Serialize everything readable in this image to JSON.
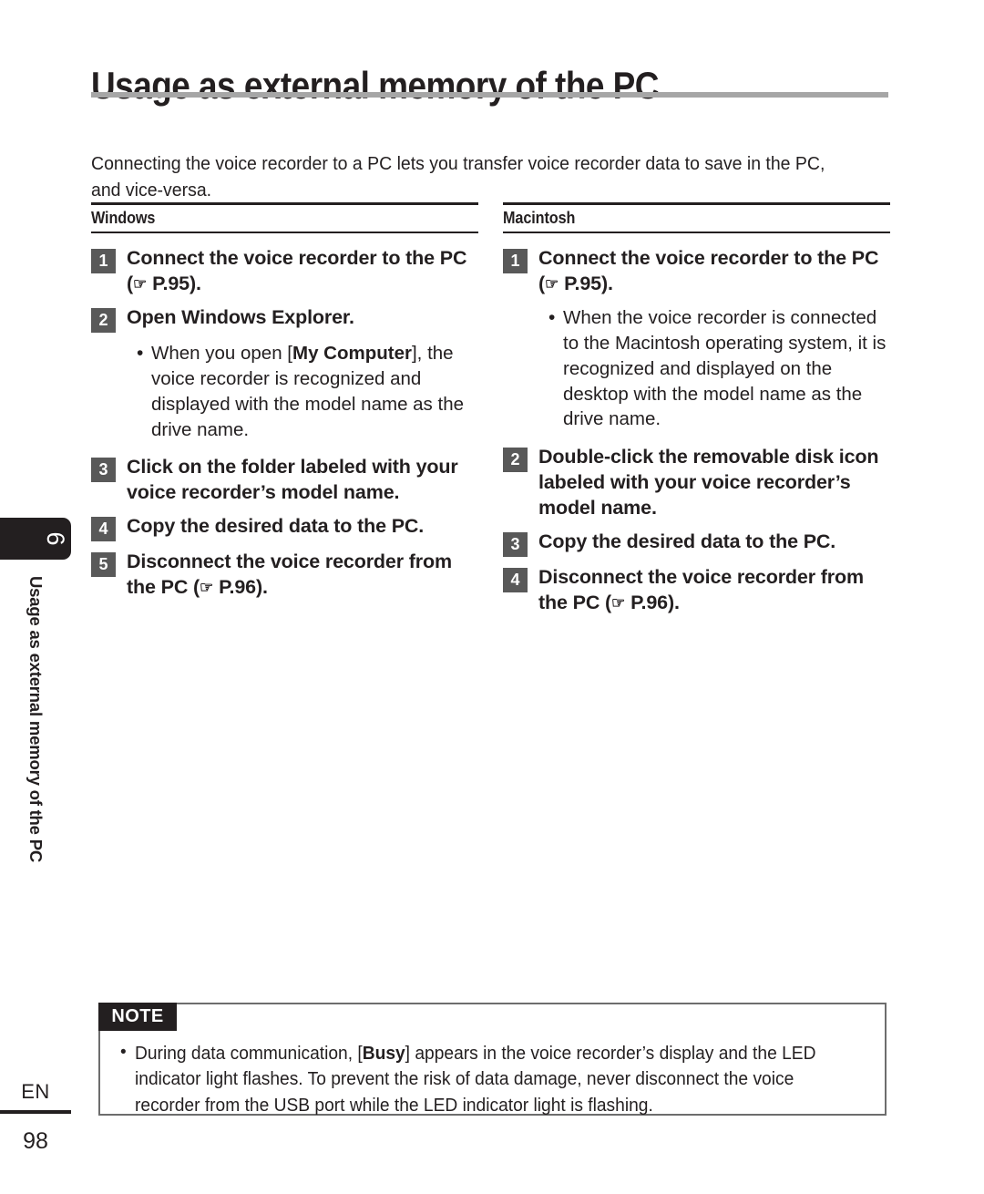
{
  "page": {
    "title": "Usage as external memory of the PC",
    "intro": "Connecting the voice recorder to a PC lets you transfer voice recorder data to save in the PC, and vice-versa.",
    "chapter_number": "6",
    "chapter_running_title": "Usage as external memory of the PC",
    "language_code": "EN",
    "page_number": "98"
  },
  "columns": [
    {
      "heading": "Windows",
      "steps": [
        {
          "number": "1",
          "text_before": "Connect the voice recorder to the PC (",
          "hand_icon": "☞",
          "reference": " P.95",
          "text_after": ")."
        },
        {
          "number": "2",
          "text_before": "Open Windows Explorer.",
          "hand_icon": "",
          "reference": "",
          "text_after": ""
        },
        {
          "number": "3",
          "text_before": "Click on the folder labeled with your voice recorder’s model name.",
          "hand_icon": "",
          "reference": "",
          "text_after": ""
        },
        {
          "number": "4",
          "text_before": "Copy the desired data to the PC.",
          "hand_icon": "",
          "reference": "",
          "text_after": ""
        },
        {
          "number": "5",
          "text_before": "Disconnect the voice recorder from the PC (",
          "hand_icon": "☞",
          "reference": " P.96",
          "text_after": ")."
        }
      ],
      "bullets": [
        {
          "after_step": "2",
          "part1": "When you open [",
          "bold": "My Computer",
          "part2": "], the voice recorder is recognized and displayed with the model name as the drive name."
        }
      ]
    },
    {
      "heading": "Macintosh",
      "steps": [
        {
          "number": "1",
          "text_before": "Connect the voice recorder to the PC (",
          "hand_icon": "☞",
          "reference": " P.95",
          "text_after": ")."
        },
        {
          "number": "2",
          "text_before": "Double-click the removable disk icon labeled with your voice recorder’s model name.",
          "hand_icon": "",
          "reference": "",
          "text_after": ""
        },
        {
          "number": "3",
          "text_before": "Copy the desired data to the PC.",
          "hand_icon": "",
          "reference": "",
          "text_after": ""
        },
        {
          "number": "4",
          "text_before": "Disconnect the voice recorder from the PC (",
          "hand_icon": "☞",
          "reference": " P.96",
          "text_after": ")."
        }
      ],
      "bullets": [
        {
          "after_step": "1",
          "part1": "When the voice recorder is connected to the Macintosh operating system, it is recognized and displayed on the desktop with the model name as the drive name.",
          "bold": "",
          "part2": ""
        }
      ]
    }
  ],
  "note": {
    "label": "NOTE",
    "bullet_marker": "•",
    "part1": "During data communication, [",
    "bold": "Busy",
    "part2": "] appears in the voice recorder’s display and the LED indicator light flashes. To prevent the risk of data damage, never disconnect the voice recorder from the USB port while the LED indicator light is flashing."
  },
  "colors": {
    "title_bar": "#a6a6a6",
    "step_number_box": "#595959",
    "tab_black": "#231f20",
    "note_border": "#6d6d6d"
  }
}
